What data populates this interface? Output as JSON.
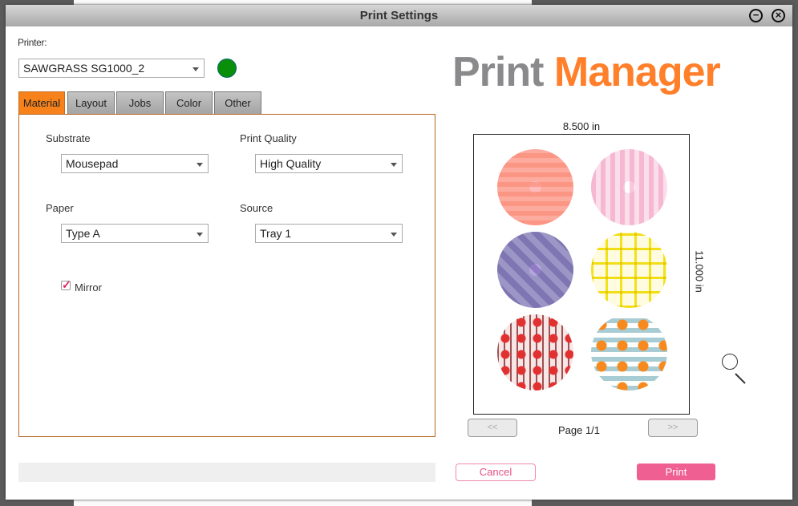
{
  "window": {
    "title": "Print Settings"
  },
  "printer": {
    "label": "Printer:",
    "value": "SAWGRASS SG1000_2",
    "status_color": "#0a8f0a"
  },
  "tabs": [
    {
      "label": "Material"
    },
    {
      "label": "Layout"
    },
    {
      "label": "Jobs"
    },
    {
      "label": "Color"
    },
    {
      "label": "Other"
    }
  ],
  "material": {
    "substrate": {
      "label": "Substrate",
      "value": "Mousepad"
    },
    "print_quality": {
      "label": "Print Quality",
      "value": "High Quality"
    },
    "paper": {
      "label": "Paper",
      "value": "Type A"
    },
    "source": {
      "label": "Source",
      "value": "Tray 1"
    },
    "mirror": {
      "label": "Mirror",
      "checked": true
    }
  },
  "logo": {
    "word1": "Print",
    "word2": "Manager",
    "color1": "#8a8a8c",
    "color2": "#ff7f2a"
  },
  "preview": {
    "width_label": "8.500 in",
    "height_label": "11.000 in",
    "page_label": "Page 1/1",
    "prev": "<<",
    "next": ">>"
  },
  "actions": {
    "cancel": "Cancel",
    "print": "Print",
    "accent": "#ef5f91"
  }
}
